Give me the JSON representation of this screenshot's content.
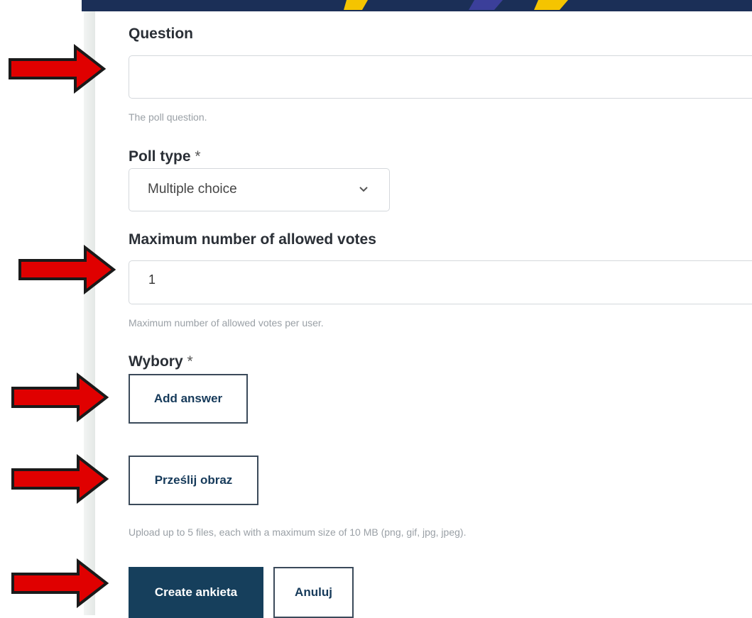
{
  "form": {
    "question": {
      "label": "Question",
      "value": "",
      "help": "The poll question."
    },
    "poll_type": {
      "label": "Poll type",
      "required_mark": "*",
      "selected": "Multiple choice"
    },
    "max_votes": {
      "label": "Maximum number of allowed votes",
      "value": "1",
      "help": "Maximum number of allowed votes per user."
    },
    "choices": {
      "label": "Wybory",
      "required_mark": "*",
      "add_answer_label": "Add answer"
    },
    "upload": {
      "button_label": "Prześlij obraz",
      "help": "Upload up to 5 files, each with a maximum size of 10 MB (png, gif, jpg, jpeg)."
    },
    "actions": {
      "create_label": "Create ankieta",
      "cancel_label": "Anuluj"
    }
  },
  "colors": {
    "primary_button": "#163f5c",
    "header_bar": "#1b2f57",
    "arrow": "#e00000"
  },
  "icons": {
    "select_chevron": "chevron-down-icon",
    "annotation": "red-arrow-icon"
  }
}
